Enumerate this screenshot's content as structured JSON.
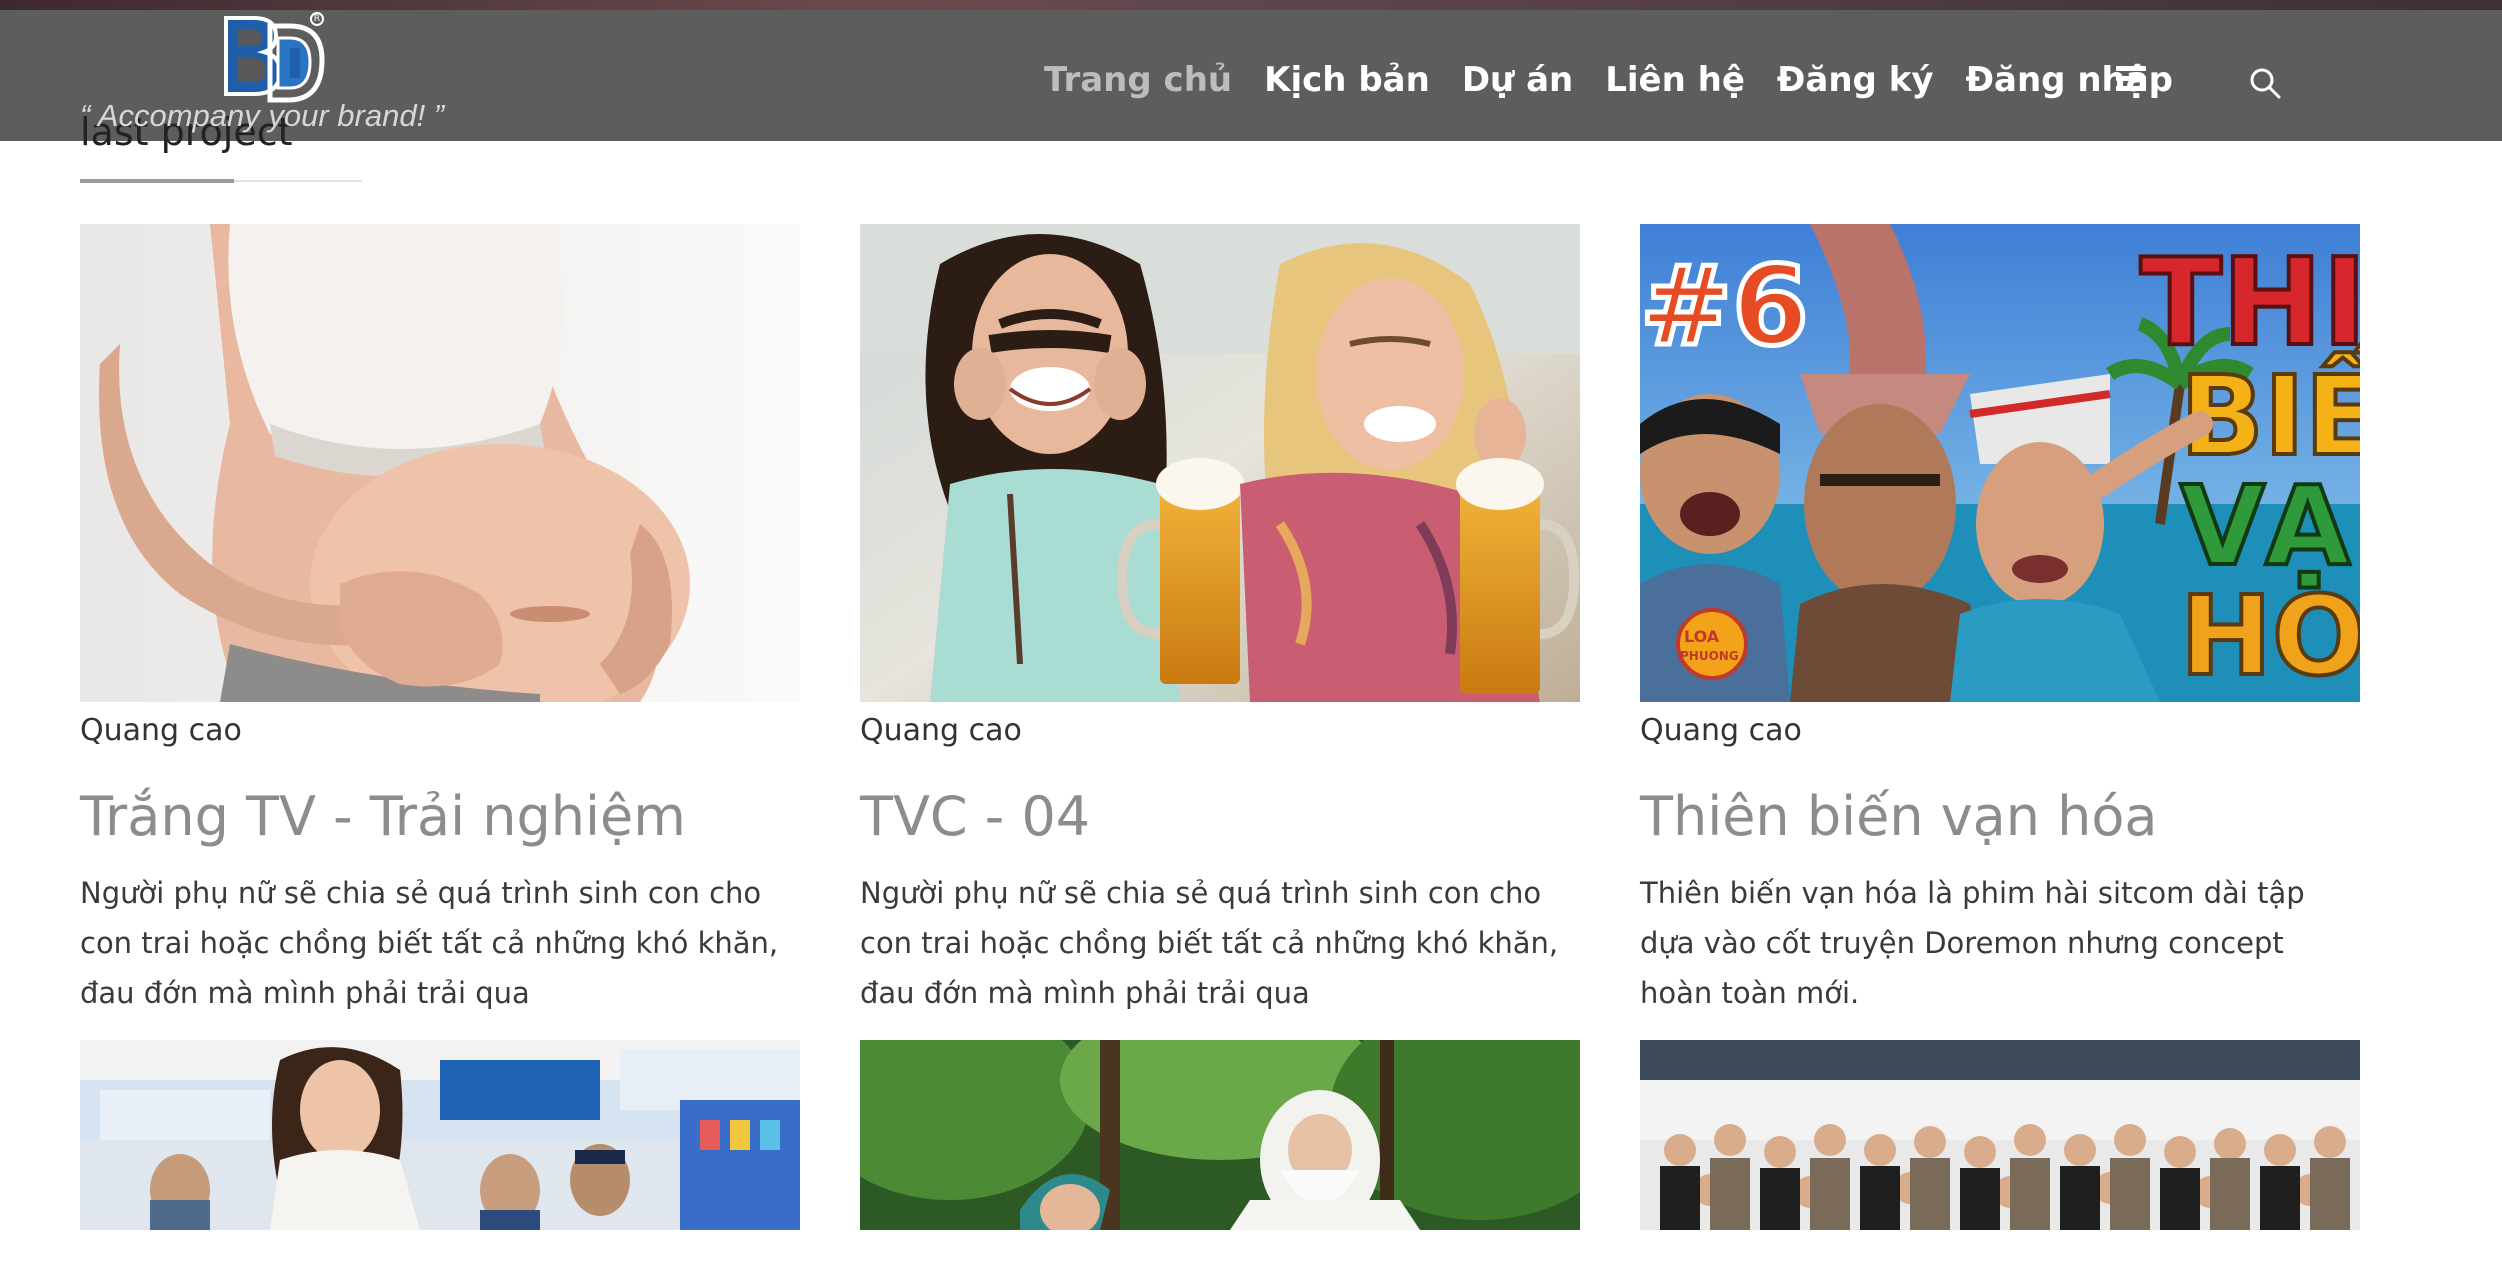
{
  "header": {
    "logo_alt": "BD logo",
    "tagline": "“ Accompany your brand! ”",
    "nav": [
      {
        "label": "Trang chủ",
        "active": true
      },
      {
        "label": "Kịch bản",
        "active": false
      },
      {
        "label": "Dự án",
        "active": false
      },
      {
        "label": "Liên hệ",
        "active": false
      },
      {
        "label": "Đăng ký",
        "active": false
      },
      {
        "label": "Đăng nhập",
        "active": false
      }
    ],
    "menu_icon": "hamburger-icon",
    "search_icon": "search-icon"
  },
  "section": {
    "title": "last project"
  },
  "projects": [
    {
      "category": "Quang cao",
      "title": "Trắng TV - Trải nghiệm",
      "description": "Người phụ nữ sẽ chia sẻ quá trình sinh con cho con trai hoặc chồng biết tất cả những khó khăn, đau đớn mà mình phải trải qua"
    },
    {
      "category": "Quang cao",
      "title": "TVC - 04",
      "description": "Người phụ nữ sẽ chia sẻ quá trình sinh con cho con trai hoặc chồng biết tất cả những khó khăn, đau đớn mà mình phải trải qua"
    },
    {
      "category": "Quang cao",
      "title": "Thiên biến vạn hóa",
      "description": "Thiên biến vạn hóa là phim hài sitcom dài tập dựa vào cốt truyện Doremon nhưng concept hoàn toàn mới."
    }
  ],
  "thumbnails": [
    {
      "name": "supermarket-thumbnail"
    },
    {
      "name": "forest-thumbnail"
    },
    {
      "name": "group-photo-thumbnail"
    }
  ],
  "colors": {
    "header_bg": "#585858",
    "nav_text": "#ffffff",
    "nav_active": "#bdbdbd",
    "title_gray": "#8c8c8c",
    "logo_blue": "#1f5ea8"
  }
}
